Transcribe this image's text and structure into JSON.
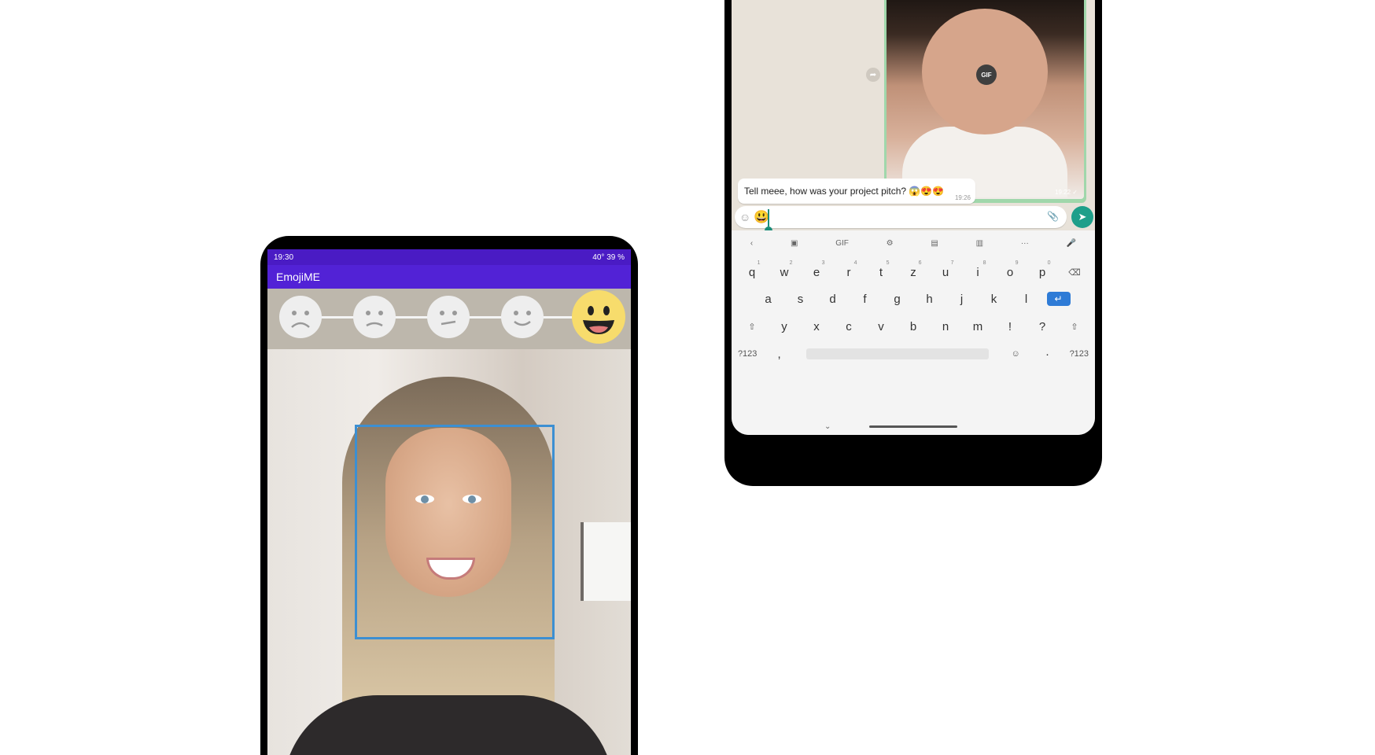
{
  "left_phone": {
    "status": {
      "time": "19:30",
      "right": "40°  39 %"
    },
    "app_title": "EmojiME",
    "mood_faces": [
      {
        "name": "very-sad-face-icon"
      },
      {
        "name": "sad-face-icon"
      },
      {
        "name": "neutral-face-icon"
      },
      {
        "name": "slight-smile-face-icon"
      },
      {
        "name": "happy-face-icon",
        "active": true
      }
    ],
    "face_box_color": "#3c8fd2",
    "accent": "#5222d6"
  },
  "right_phone": {
    "gif_badge": "GIF",
    "gif_time": "19:22 ✓",
    "message": {
      "text": "Tell meee, how was your project pitch? 😱😍😍",
      "time": "19:26"
    },
    "composer_value": "😃",
    "keyboard": {
      "tools": [
        "‹",
        "▣",
        "GIF",
        "⚙",
        "▤",
        "▥",
        "···",
        "🎤"
      ],
      "row1": [
        "q",
        "w",
        "e",
        "r",
        "t",
        "z",
        "u",
        "i",
        "o",
        "p"
      ],
      "row1_hints": [
        "1",
        "2",
        "3",
        "4",
        "5",
        "6",
        "7",
        "8",
        "9",
        "0"
      ],
      "row2": [
        "a",
        "s",
        "d",
        "f",
        "g",
        "h",
        "j",
        "k",
        "l"
      ],
      "row3": [
        "y",
        "x",
        "c",
        "v",
        "b",
        "n",
        "m",
        "!",
        "?"
      ],
      "bottom": {
        "sym": "?123",
        "comma": ",",
        "emoji": "☺",
        "period": "·",
        "sym2": "?123"
      },
      "shift": "⇧",
      "backspace": "⌫",
      "enter": "↵"
    },
    "send_color": "#1e9f8a"
  }
}
